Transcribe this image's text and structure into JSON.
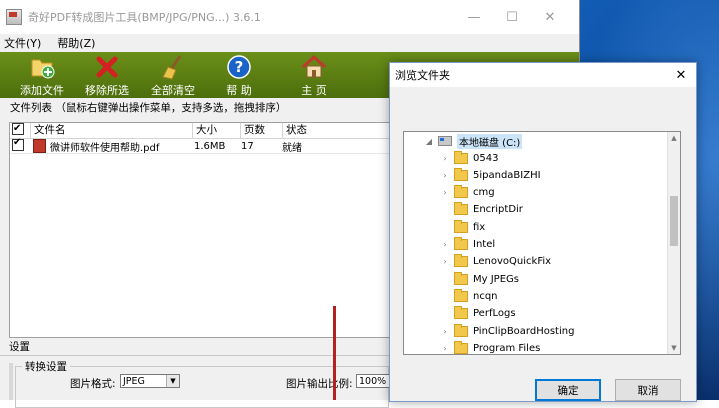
{
  "app": {
    "title": "奇好PDF转成图片工具(BMP/JPG/PNG...) 3.6.1",
    "window_controls": [
      "—",
      "☐",
      "✕"
    ]
  },
  "menu": [
    "文件(Y)",
    "帮助(Z)"
  ],
  "toolbar": [
    {
      "label": "添加文件",
      "icon": "add-file-icon"
    },
    {
      "label": "移除所选",
      "icon": "remove-red-x-icon"
    },
    {
      "label": "全部清空",
      "icon": "broom-icon"
    },
    {
      "label": "帮 助",
      "icon": "help-question-icon"
    },
    {
      "label": "主 页",
      "icon": "home-icon"
    }
  ],
  "hint": "文件列表  （鼠标右键弹出操作菜单，支持多选，拖拽排序）",
  "list": {
    "headers": [
      "文件名",
      "大小",
      "页数",
      "状态"
    ],
    "rows": [
      {
        "name": "微讲师软件使用帮助.pdf",
        "size": "1.6MB",
        "pages": "17",
        "status": "就绪"
      }
    ]
  },
  "settings": {
    "title": "设置",
    "group": "转换设置",
    "format_label": "图片格式:",
    "format_value": "JPEG",
    "ratio_label": "图片输出比例:",
    "ratio_value": "100%"
  },
  "dialog": {
    "title": "浏览文件夹",
    "close": "✕",
    "root": "本地磁盘 (C:)",
    "folders": [
      "0543",
      "5ipandaBIZHI",
      "cmg",
      "EncriptDir",
      "fix",
      "Intel",
      "LenovoQuickFix",
      "My JPEGs",
      "ncqn",
      "PerfLogs",
      "PinClipBoardHosting",
      "Program Files"
    ],
    "ok": "确定",
    "cancel": "取消"
  },
  "colors": {
    "toolbar_green": "#5a7d12",
    "folder_yellow": "#f1c84b",
    "accent_blue": "#0078d7"
  }
}
